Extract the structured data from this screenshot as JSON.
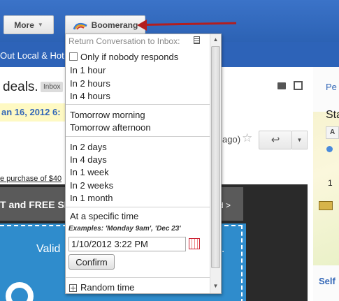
{
  "toolbar": {
    "more_label": "More",
    "boomerang_label": "Boomerang"
  },
  "labels_bar": {
    "text": "Out Local & Hot I"
  },
  "message": {
    "subject": "deals.",
    "inbox_chip": "Inbox",
    "date": "an 16, 2012 6:",
    "ago": "ago)"
  },
  "promo": {
    "link_text": "e purchase of $40",
    "banner_left": "T and FREE SH",
    "banner_right": "d >",
    "valid": "Valid",
    "twelve": "2."
  },
  "sidebar": {
    "name": "Pe",
    "heading": "Sta",
    "add_label": "A",
    "one": "1",
    "self_link": "Self"
  },
  "dropdown": {
    "header": "Return Conversation to Inbox:",
    "checkbox_label": "Only if nobody responds",
    "group_hours": [
      "In 1 hour",
      "In 2 hours",
      "In 4 hours"
    ],
    "group_tomorrow": [
      "Tomorrow morning",
      "Tomorrow afternoon"
    ],
    "group_days": [
      "In 2 days",
      "In 4 days",
      "In 1 week",
      "In 2 weeks",
      "In 1 month"
    ],
    "specific_label": "At a specific time",
    "examples": "Examples: 'Monday 9am', 'Dec 23'",
    "time_value": "1/10/2012 3:22 PM",
    "confirm_label": "Confirm",
    "random_label": "Random time"
  },
  "icons": {
    "boomerang_logo": "boomerang-logo-icon",
    "calendar": "calendar-icon",
    "document": "document-icon",
    "plus": "plus-box-icon"
  },
  "colors": {
    "header_blue": "#2d63b8",
    "arrow_red": "#b31e1e",
    "date_highlight": "#fef9c3",
    "promo_blue": "#2f8ccc"
  }
}
